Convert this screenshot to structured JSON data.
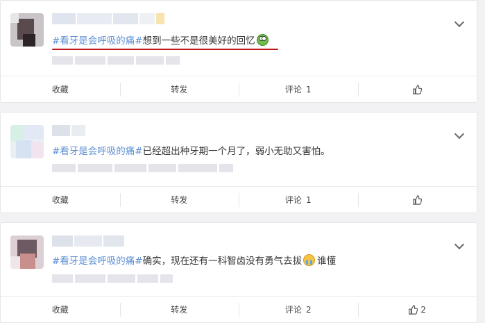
{
  "posts": [
    {
      "topic": "#看牙是会呼吸的痛#",
      "text": "想到一些不是很美好的回忆",
      "emoji": "frog-emoji",
      "actions": {
        "collect": "收藏",
        "repost": "转发",
        "comment": "评论",
        "comment_count": "1",
        "like_count": ""
      }
    },
    {
      "topic": "#看牙是会呼吸的痛#",
      "text": "已经超出种牙期一个月了，弱小无助又害怕。",
      "emoji": "",
      "actions": {
        "collect": "收藏",
        "repost": "转发",
        "comment": "评论",
        "comment_count": "1",
        "like_count": ""
      }
    },
    {
      "topic": "#看牙是会呼吸的痛#",
      "text": "确实，现在还有一科智齿没有勇气去拔",
      "text_after": "谁懂",
      "emoji": "crying-emoji",
      "actions": {
        "collect": "收藏",
        "repost": "转发",
        "comment": "评论",
        "comment_count": "2",
        "like_count": "2"
      }
    }
  ],
  "colors": {
    "topic": "#5d8fd3",
    "underline": "#c0171b",
    "background": "#f2f2f5"
  },
  "icons": [
    "chevron-down-icon",
    "thumbs-up-icon"
  ]
}
